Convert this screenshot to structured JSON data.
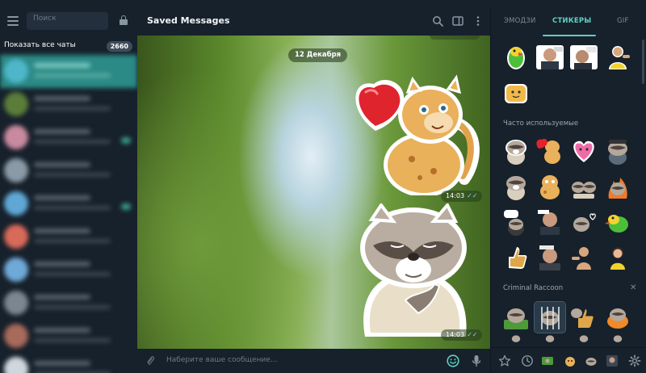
{
  "sidebar": {
    "search_placeholder": "Поиск",
    "show_all_label": "Показать все чаты",
    "unread_count": "2660"
  },
  "chat": {
    "title": "Saved Messages",
    "date_separator": "12 Декабря",
    "messages": [
      {
        "sticker": "cheetah-heart-sticker",
        "time": "14:03",
        "ticks": "✓✓"
      },
      {
        "sticker": "raccoon-pointing-sticker",
        "time": "14:03",
        "ticks": "✓✓"
      }
    ],
    "composer_placeholder": "Наберите ваше сообщение..."
  },
  "panel": {
    "tabs": [
      {
        "label": "ЭМОДЗИ",
        "active": false
      },
      {
        "label": "СТИКЕРЫ",
        "active": true
      },
      {
        "label": "GIF",
        "active": false
      }
    ],
    "frequent_title": "Часто используемые",
    "pack_title": "Criminal Raccoon",
    "close_symbol": "✕"
  },
  "colors": {
    "accent": "#5fd0c4",
    "background": "#17212b",
    "active_chat": "#2b8a86"
  }
}
